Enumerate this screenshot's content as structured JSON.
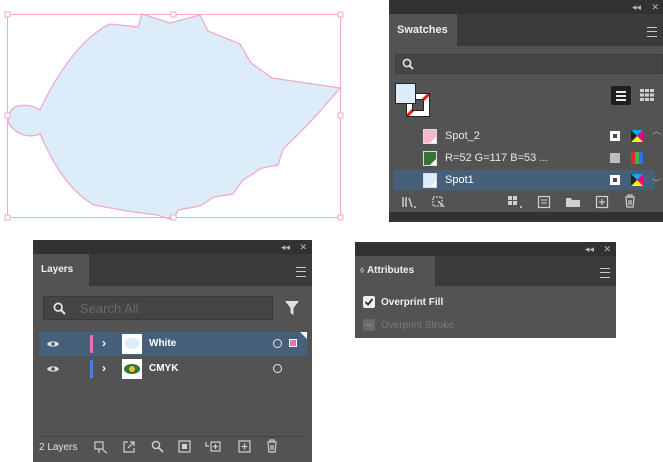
{
  "swatches": {
    "tab_label": "Swatches",
    "items": [
      {
        "name": "Spot_2",
        "color": "#f4b7cf"
      },
      {
        "name": "R=52 G=117 B=53 ...",
        "color": "#347535"
      },
      {
        "name": "Spot1",
        "color": "#dcecf8"
      }
    ],
    "selected": "Spot1"
  },
  "layers": {
    "tab_label": "Layers",
    "search_placeholder": "Search All",
    "items": [
      {
        "name": "White",
        "color": "#e86fb0"
      },
      {
        "name": "CMYK",
        "color": "#4a7fe8"
      }
    ],
    "count_label": "2 Layers"
  },
  "attributes": {
    "tab_label": "Attributes",
    "overprint_fill": {
      "label": "Overprint Fill",
      "checked": true
    },
    "overprint_stroke": {
      "label": "Overprint Stroke",
      "checked": false
    }
  },
  "artwork": {
    "fill": "#dcecf8",
    "stroke": "#f2a8d0"
  }
}
